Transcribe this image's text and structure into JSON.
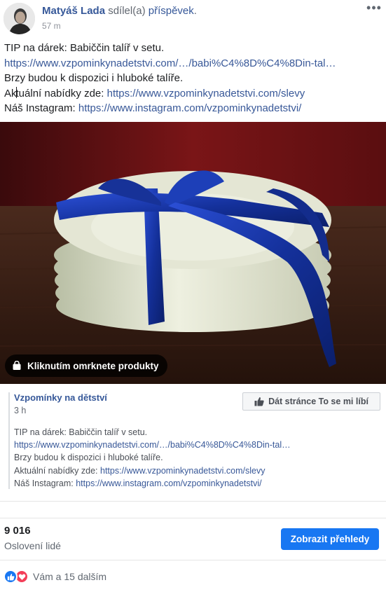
{
  "header": {
    "author_name": "Matyáš Lada",
    "action_text": " sdílel(a) ",
    "action_link": "příspěvek",
    "action_end": ".",
    "timestamp": "57 m",
    "more_label": "•••"
  },
  "post": {
    "lines": [
      "TIP na dárek: Babiččin talíř v setu.",
      "https://www.vzpominkynadetstvi.com/…/babi%C4%8D%C4%8Din-tal…",
      "Brzy budou k dispozici i hluboké talíře."
    ],
    "offers_prefix_a": "Ak",
    "offers_prefix_b": "tuální nabídky zde: ",
    "offers_link": "https://www.vzpominkynadetstvi.com/slevy",
    "instagram_prefix": "Náš Instagram: ",
    "instagram_link": "https://www.instagram.com/vzpominkynadetstvi/"
  },
  "photo": {
    "product_tag_label": "Kliknutím omrknete produkty",
    "icon": "shopping-bag-icon"
  },
  "shared_page": {
    "name": "Vzpomínky na dětství",
    "time": "3 h",
    "like_button_label": "Dát stránce To se mi líbí",
    "text_lines": [
      "TIP na dárek: Babiččin talíř v setu.",
      "https://www.vzpominkynadetstvi.com/…/babi%C4%8D%C4%8Din-tal…",
      "Brzy budou k dispozici i hluboké talíře."
    ],
    "offers_prefix": "Aktuální nabídky zde: ",
    "offers_link": "https://www.vzpominkynadetstvi.com/slevy",
    "instagram_prefix": "Náš Instagram: ",
    "instagram_link": "https://www.instagram.com/vzpominkynadetstvi/"
  },
  "insights": {
    "reach_count": "9 016",
    "reach_label": "Oslovení lidé",
    "button_label": "Zobrazit přehledy"
  },
  "reactions": {
    "types": [
      "like",
      "love"
    ],
    "summary": "Vám a 15 dalším"
  },
  "colors": {
    "link": "#385898",
    "author": "#365899",
    "primary_button": "#1877f2",
    "love": "#f33e58",
    "ribbon": "#1a3aa8"
  }
}
